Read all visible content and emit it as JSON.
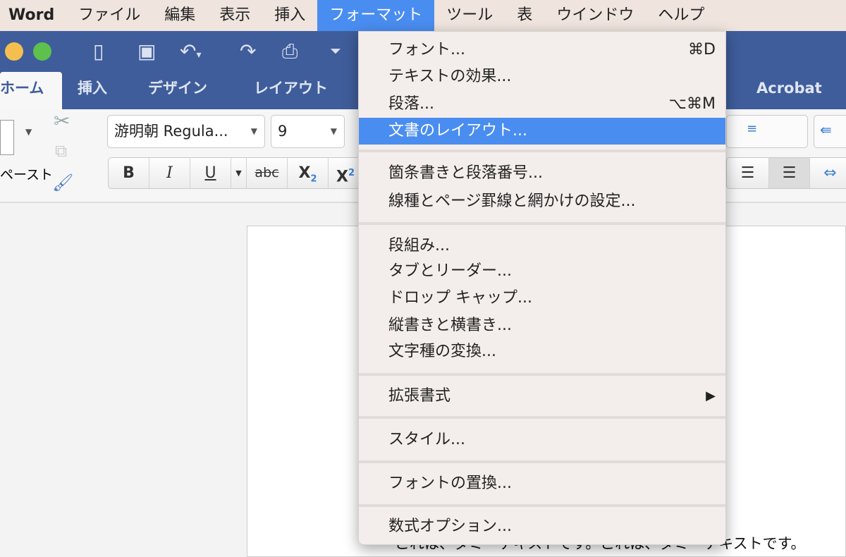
{
  "menubar": {
    "app": "Word",
    "items": [
      "ファイル",
      "編集",
      "表示",
      "挿入",
      "フォーマット",
      "ツール",
      "表",
      "ウインドウ",
      "ヘルプ"
    ],
    "active": "フォーマット"
  },
  "toolbar": {
    "icons": [
      "sidebar-icon",
      "save-icon",
      "undo-icon",
      "redo-icon",
      "print-icon",
      "customize-icon"
    ]
  },
  "tabs": [
    "ホーム",
    "挿入",
    "デザイン",
    "レイアウト",
    "Acrobat"
  ],
  "ribbon": {
    "paste_label": "ペースト",
    "font_name": "游明朝 Regula...",
    "font_size": "9",
    "bold": "B",
    "italic": "I",
    "underline": "U",
    "strike": "abc",
    "subscript": "X",
    "superscript": "X",
    "sub_mark": "2",
    "sup_mark": "2"
  },
  "format_menu": {
    "groups": [
      [
        {
          "label": "フォント...",
          "shortcut": "⌘D"
        },
        {
          "label": "テキストの効果..."
        },
        {
          "label": "段落...",
          "shortcut": "⌥⌘M"
        },
        {
          "label": "文書のレイアウト...",
          "highlighted": true
        }
      ],
      [
        {
          "label": "箇条書きと段落番号..."
        },
        {
          "label": "線種とページ罫線と網かけの設定..."
        }
      ],
      [
        {
          "label": "段組み..."
        },
        {
          "label": "タブとリーダー..."
        },
        {
          "label": "ドロップ キャップ..."
        },
        {
          "label": "縦書きと横書き..."
        },
        {
          "label": "文字種の変換..."
        }
      ],
      [
        {
          "label": "拡張書式",
          "shortcut": "▶"
        }
      ],
      [
        {
          "label": "スタイル..."
        }
      ],
      [
        {
          "label": "フォントの置換..."
        }
      ],
      [
        {
          "label": "数式オプション..."
        }
      ]
    ]
  },
  "document": {
    "text": "これは、ダミーテキストです。これは、ダミーテキストです。"
  },
  "colors": {
    "accent": "#4a8df0",
    "titlebar": "#3f5d9b"
  }
}
